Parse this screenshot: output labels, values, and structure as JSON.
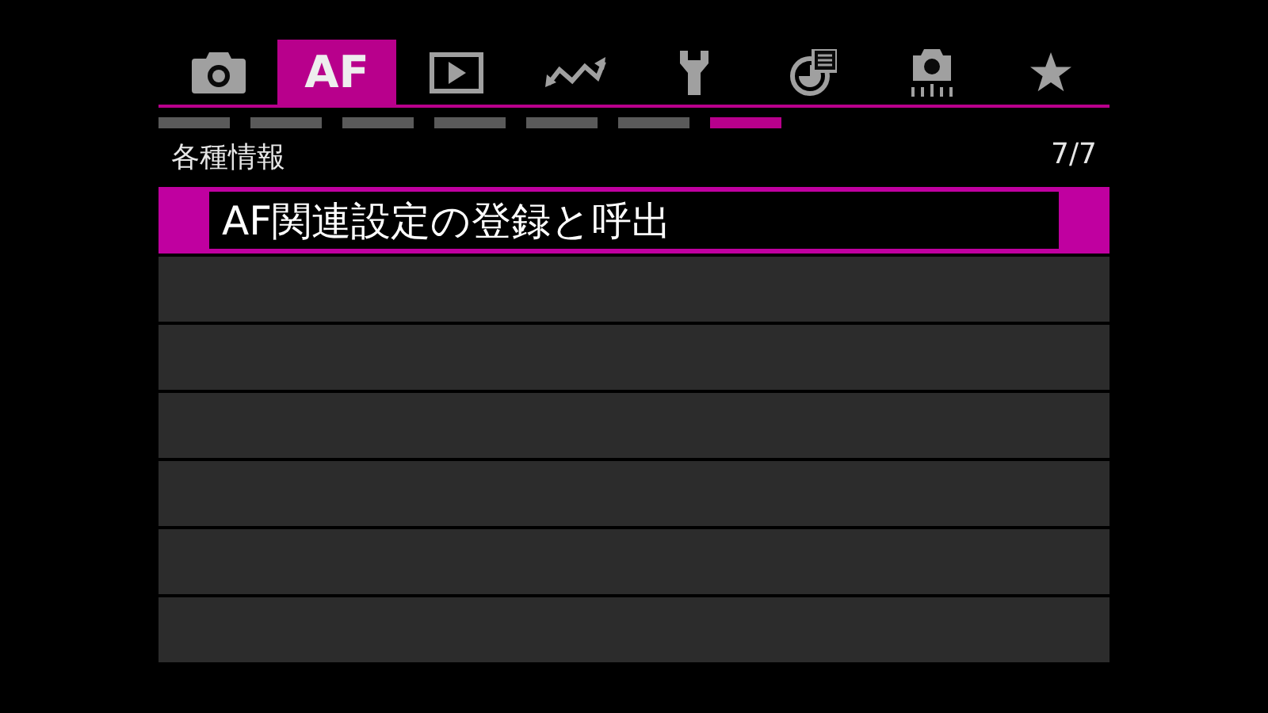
{
  "tabs": [
    {
      "kind": "camera",
      "selected": false
    },
    {
      "kind": "text",
      "label": "AF",
      "selected": true
    },
    {
      "kind": "playback",
      "selected": false
    },
    {
      "kind": "wave",
      "selected": false
    },
    {
      "kind": "wrench",
      "selected": false
    },
    {
      "kind": "chart",
      "selected": false
    },
    {
      "kind": "custom",
      "selected": false
    },
    {
      "kind": "star",
      "selected": false
    }
  ],
  "pages": [
    {
      "selected": false
    },
    {
      "selected": false
    },
    {
      "selected": false
    },
    {
      "selected": false
    },
    {
      "selected": false
    },
    {
      "selected": false
    },
    {
      "selected": true
    }
  ],
  "section": {
    "title": "各種情報",
    "page": "7/7"
  },
  "rows": [
    {
      "label": "AF関連設定の登録と呼出",
      "selected": true
    },
    {
      "selected": false
    },
    {
      "selected": false
    },
    {
      "selected": false
    },
    {
      "selected": false
    },
    {
      "selected": false
    },
    {
      "selected": false
    }
  ]
}
